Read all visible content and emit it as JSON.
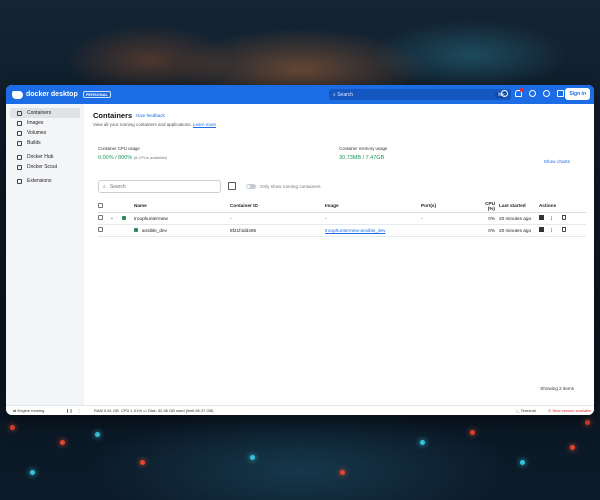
{
  "app": {
    "logo_text": "docker desktop",
    "edition_badge": "PERSONAL",
    "search_placeholder": "Search",
    "search_shortcut": "⌘K",
    "signin_label": "Sign in"
  },
  "sidebar": {
    "items": [
      {
        "label": "Containers",
        "icon": "containers-icon",
        "active": true
      },
      {
        "label": "Images",
        "icon": "images-icon"
      },
      {
        "label": "Volumes",
        "icon": "volumes-icon"
      },
      {
        "label": "Builds",
        "icon": "builds-icon"
      },
      {
        "label": "Docker Hub",
        "icon": "docker-hub-icon"
      },
      {
        "label": "Docker Scout",
        "icon": "docker-scout-icon"
      },
      {
        "label": "Extensions",
        "icon": "extensions-icon"
      }
    ]
  },
  "page": {
    "title": "Containers",
    "feedback_link": "Give feedback",
    "subtitle": "View all your running containers and applications.",
    "learn_more": "Learn more",
    "cpu_label": "Container CPU usage",
    "cpu_value": "0.00% / 800%",
    "cpu_sub": "(8 CPUs available)",
    "mem_label": "Container memory usage",
    "mem_value": "30.73MB / 7.47GB",
    "show_charts": "Show charts",
    "search_placeholder": "Search",
    "toggle_label": "Only show running containers",
    "showing": "Showing 2 items"
  },
  "table": {
    "headers": [
      "",
      "",
      "",
      "Name",
      "Container ID",
      "Image",
      "Port(s)",
      "CPU (%)",
      "Last started",
      "Actions"
    ],
    "rows": [
      {
        "name": "troophuntermew",
        "id": "-",
        "image": "-",
        "ports": "-",
        "cpu": "0%",
        "started": "20 minutes ago"
      },
      {
        "name": "ansible_dev",
        "id": "8f21f4dd496",
        "image": "troophuntermew-ansible_dev",
        "ports": "",
        "cpu": "0%",
        "started": "20 minutes ago"
      }
    ]
  },
  "footer": {
    "engine": "Engine running",
    "ram": "RAM 0.61 GB",
    "cpu": "CPU 1.01%",
    "disk": "Disk: 32.96 GB used (limit 96.37 GB)",
    "terminal": "Terminal",
    "update": "New version available"
  }
}
